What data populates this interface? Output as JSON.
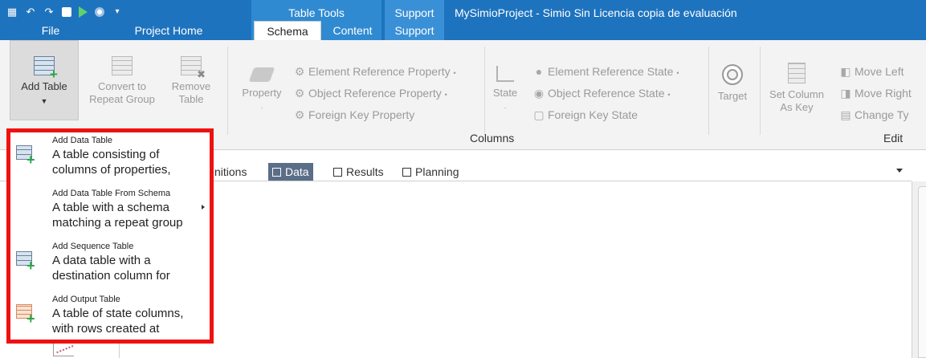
{
  "title_bar": {
    "window_title": "MySimioProject - Simio Sin Licencia copia de evaluación",
    "context_groups": [
      {
        "label": "Table Tools"
      },
      {
        "label": "Support"
      }
    ]
  },
  "tabs": [
    {
      "label": "File"
    },
    {
      "label": "Project Home"
    },
    {
      "label": "Schema"
    },
    {
      "label": "Content"
    },
    {
      "label": "Support"
    }
  ],
  "ribbon": {
    "add_table": {
      "label": "Add Table"
    },
    "convert_to": {
      "label_line1": "Convert to",
      "label_line2": "Repeat Group"
    },
    "remove": {
      "label_line1": "Remove",
      "label_line2": "Table"
    },
    "property": {
      "label": "Property"
    },
    "element_reference_property": "Element Reference Property",
    "object_reference_property": "Object Reference Property",
    "foreign_key_property": "Foreign Key Property",
    "state": {
      "label": "State"
    },
    "element_reference_state": "Element Reference State",
    "object_reference_state": "Object Reference State",
    "foreign_key_state": "Foreign Key State",
    "target": {
      "label": "Target"
    },
    "set_column_as_key": {
      "label_line1": "Set Column",
      "label_line2": "As Key"
    },
    "move_left": "Move Left",
    "move_right": "Move Right",
    "change_type": "Change Ty",
    "group_columns": "Columns",
    "group_edit": "Edit"
  },
  "doc_tabs": [
    {
      "label": "nitions"
    },
    {
      "label": "Data"
    },
    {
      "label": "Results"
    },
    {
      "label": "Planning"
    }
  ],
  "dropdown": {
    "items": [
      {
        "title": "Add Data Table",
        "desc_line1": "A table consisting of",
        "desc_line2": "columns of properties,"
      },
      {
        "title": "Add Data Table From Schema",
        "desc_line1": "A table with a schema",
        "desc_line2": "matching a repeat group"
      },
      {
        "title": "Add Sequence Table",
        "desc_line1": "A data table with a",
        "desc_line2": "destination column for"
      },
      {
        "title": "Add Output Table",
        "desc_line1": "A table of state columns,",
        "desc_line2": "with rows created at"
      }
    ]
  },
  "colors": {
    "title_bar": "#1e73be",
    "highlight_border": "#ee1111",
    "active_doc_tab": "#5b6e88",
    "plus_green": "#2aa84a"
  }
}
